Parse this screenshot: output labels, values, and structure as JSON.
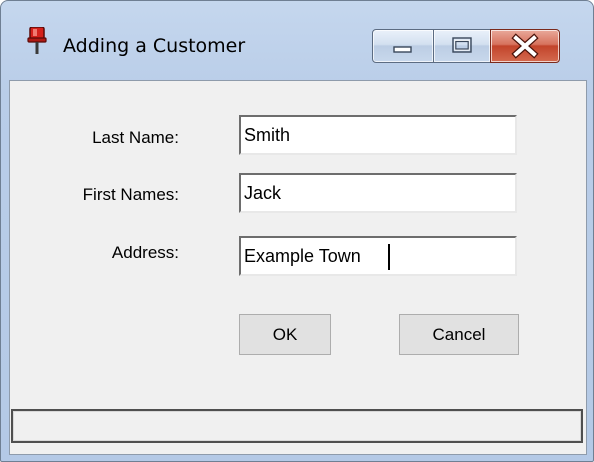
{
  "window": {
    "title": "Adding a Customer",
    "app_icon": "red-pushpin-icon",
    "caption_buttons": {
      "minimize": "minimize-icon",
      "maximize": "maximize-icon",
      "close": "close-icon"
    }
  },
  "form": {
    "last_name": {
      "label": "Last Name:",
      "value": "Smith"
    },
    "first_names": {
      "label": "First Names:",
      "value": "Jack"
    },
    "address": {
      "label": "Address:",
      "value": "Example Town"
    }
  },
  "buttons": {
    "ok_label": "OK",
    "cancel_label": "Cancel"
  },
  "status_bar": {
    "text": ""
  },
  "colors": {
    "frame": "#b9cde8",
    "client_background": "#f0f0f0",
    "close_button": "#c2442b",
    "button_face": "#e1e1e1"
  }
}
